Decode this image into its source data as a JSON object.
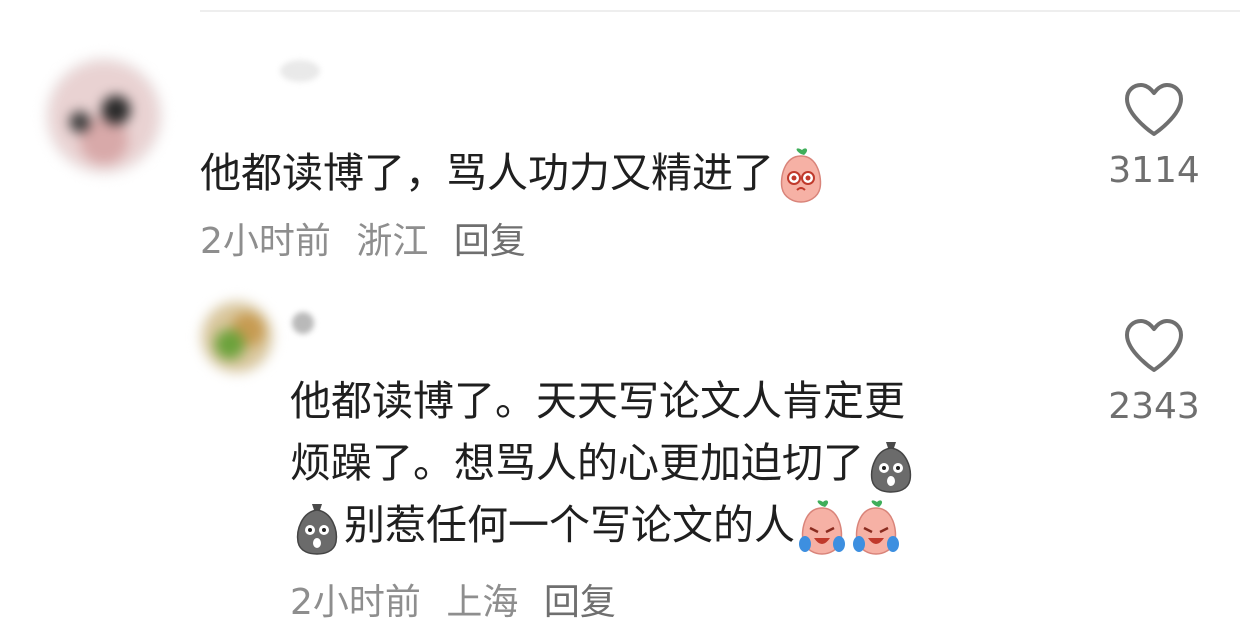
{
  "comments": [
    {
      "text_before": "他都读博了，骂人功力又精进了",
      "emoji_end": "pink-peach-face-icon",
      "time": "2小时前",
      "location": "浙江",
      "reply_label": "回复",
      "likes": "3114"
    },
    {
      "line1": "他都读博了。天天写论文人肯定更",
      "line2": "烦躁了。想骂人的心更加迫切了",
      "line3": "别惹任何一个写论文的人",
      "time": "2小时前",
      "location": "上海",
      "reply_label": "回复",
      "likes": "2343"
    }
  ],
  "colors": {
    "text": "#1f1f1f",
    "meta": "#8e8e8e",
    "heart": "#6f6f6f"
  }
}
